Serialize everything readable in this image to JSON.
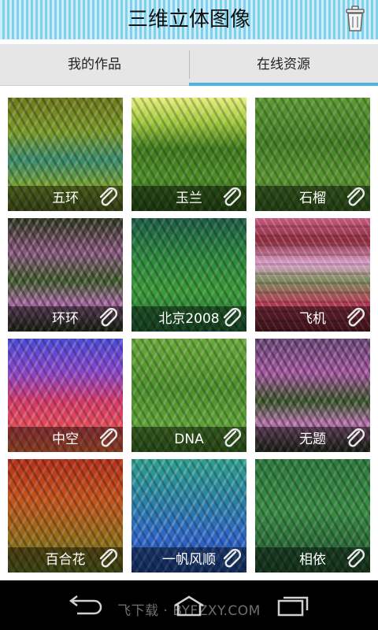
{
  "header": {
    "title": "三维立体图像",
    "trash_icon": "trash-icon"
  },
  "tabs": [
    {
      "label": "我的作品",
      "active": false
    },
    {
      "label": "在线资源",
      "active": true
    }
  ],
  "tiles": [
    {
      "label": "五环",
      "icon": "paperclip-icon"
    },
    {
      "label": "玉兰",
      "icon": "paperclip-icon"
    },
    {
      "label": "石榴",
      "icon": "paperclip-icon"
    },
    {
      "label": "环环",
      "icon": "paperclip-icon"
    },
    {
      "label": "北京2008",
      "icon": "paperclip-icon"
    },
    {
      "label": "飞机",
      "icon": "paperclip-icon"
    },
    {
      "label": "中空",
      "icon": "paperclip-icon"
    },
    {
      "label": "DNA",
      "icon": "paperclip-icon"
    },
    {
      "label": "无题",
      "icon": "paperclip-icon"
    },
    {
      "label": "百合花",
      "icon": "paperclip-icon"
    },
    {
      "label": "一帆风顺",
      "icon": "paperclip-icon"
    },
    {
      "label": "相依",
      "icon": "paperclip-icon"
    }
  ],
  "navbar": {
    "watermark": "飞下载 · BYFZXY.COM",
    "back_icon": "back-icon",
    "home_icon": "home-icon",
    "recent_icon": "recent-apps-icon"
  },
  "colors": {
    "header_stripe_light": "#cdeef8",
    "header_stripe_dark": "#7fd0ec",
    "tab_active_indicator": "#4ab3e0",
    "tab_bar": "#e6e6e6"
  }
}
